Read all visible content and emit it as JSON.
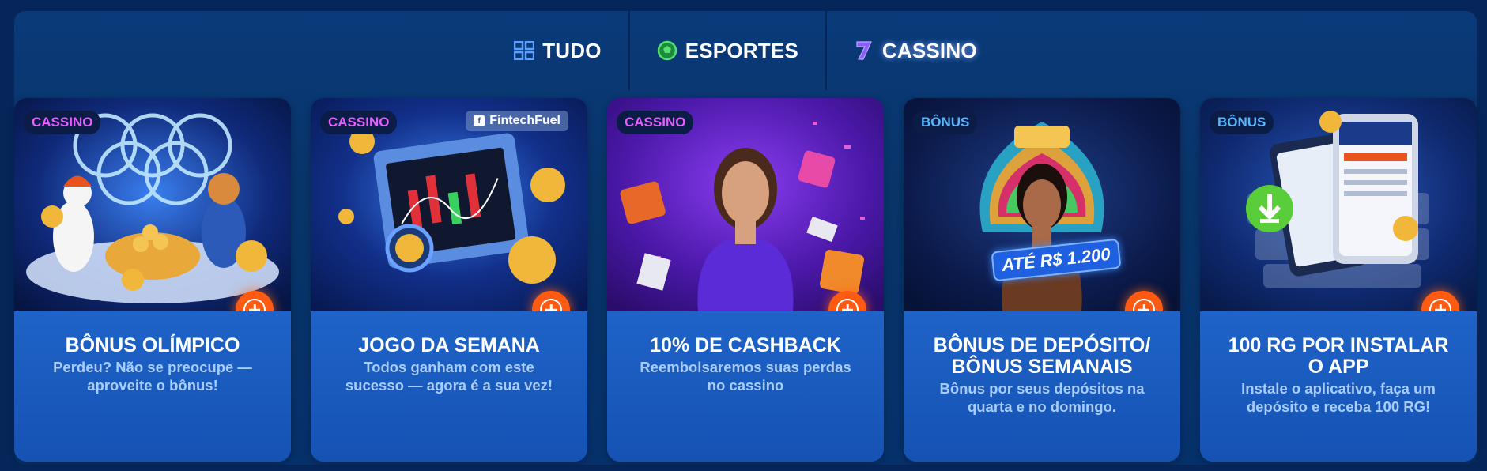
{
  "tabs": [
    {
      "label": "TUDO",
      "icon": "grid-icon"
    },
    {
      "label": "ESPORTES",
      "icon": "soccer-ball-icon"
    },
    {
      "label": "CASSINO",
      "icon": "seven-icon"
    }
  ],
  "colors": {
    "accent_orange": "#ff5a12",
    "badge_cassino": "#e65fff",
    "badge_bonus": "#59b6ff",
    "card_body": "#1756b8",
    "description": "#a9cdfa"
  },
  "cards": [
    {
      "badge": "CASSINO",
      "title": "BÔNUS OLÍMPICO",
      "description": "Perdeu? Não se preocupe — aproveite o bônus!",
      "image": "olympic-rings-animals-coins"
    },
    {
      "badge": "CASSINO",
      "sponsor": "FintechFuel",
      "title": "JOGO DA SEMANA",
      "description": "Todos ganham com este sucesso — agora é a sua vez!",
      "image": "trading-chart-coins"
    },
    {
      "badge": "CASSINO",
      "title": "10% DE CASHBACK",
      "description": "Reembolsaremos suas perdas no cassino",
      "image": "woman-purple-dress-gifts"
    },
    {
      "badge": "BÔNUS",
      "overlay": "ATÉ R$ 1.200",
      "title": "BÔNUS DE DEPÓSITO/ BÔNUS SEMANAIS",
      "description": "Bônus por seus depósitos na quarta e no domingo.",
      "image": "carnival-dancer"
    },
    {
      "badge": "BÔNUS",
      "title": "100 RG POR INSTALAR O APP",
      "description": "Instale o aplicativo, faça um depósito e receba 100 RG!",
      "image": "phones-download-app"
    }
  ]
}
